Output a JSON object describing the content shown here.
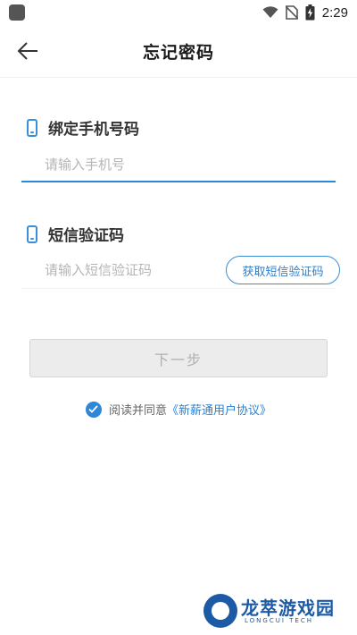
{
  "status_bar": {
    "time": "2:29",
    "icons": [
      "app-icon",
      "wifi-icon",
      "no-sim-icon",
      "battery-charging-icon"
    ]
  },
  "header": {
    "title": "忘记密码",
    "back_icon": "arrow-left-icon"
  },
  "phone_section": {
    "label": "绑定手机号码",
    "icon": "phone-icon",
    "placeholder": "请输入手机号",
    "value": ""
  },
  "code_section": {
    "label": "短信验证码",
    "icon": "phone-icon",
    "placeholder": "请输入短信验证码",
    "value": "",
    "get_code_label": "获取短信验证码"
  },
  "next_button": {
    "label": "下一步"
  },
  "agreement": {
    "checked": true,
    "text": "阅读并同意",
    "link": "《新薪通用户协议》"
  },
  "watermark": {
    "title": "龙萃游戏园",
    "subtitle": "LONGCUI TECH"
  },
  "colors": {
    "accent": "#2d86d6",
    "disabled_bg": "#ececec",
    "disabled_text": "#b0b0b0",
    "watermark": "#1c5aa6"
  }
}
